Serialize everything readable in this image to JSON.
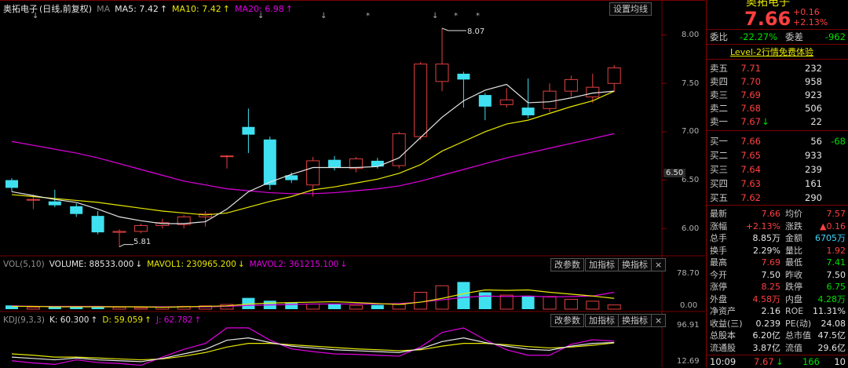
{
  "header": {
    "stock_name": "奥拓电子",
    "period": "(日线,前复权)",
    "ma_label": "MA",
    "ma5": "MA5: 7.42",
    "ma10": "MA10: 7.42",
    "ma20": "MA20: 6.98",
    "arrow_up": "↑",
    "settings_button": "设置均线"
  },
  "colors": {
    "up": "#e24040",
    "down": "#3fe0f0",
    "ma5": "#e6e6e6",
    "ma10": "#e8e800",
    "ma20": "#e000e0",
    "ma_label": "#808080"
  },
  "price_axis": {
    "ticks": [
      "8.00",
      "7.50",
      "7.00",
      "6.50",
      "6.00"
    ],
    "current_box": "6.50"
  },
  "annotations": {
    "high": "8.07",
    "low": "5.81"
  },
  "event_markers": [
    "↓",
    "↓",
    "↓",
    "↓",
    "*",
    "↓",
    "*",
    "*"
  ],
  "volume_panel": {
    "title": "VOL(5,10)",
    "volume": "VOLUME: 88533.000",
    "mavol1": "MAVOL1: 230965.200",
    "mavol2": "MAVOL2: 361215.100",
    "arrow_down": "↓",
    "btn_params": "改参数",
    "btn_add": "加指标",
    "btn_switch": "换指标",
    "btn_close": "×",
    "axis_top": "78.70",
    "axis_bottom": "0.00"
  },
  "kdj_panel": {
    "title": "KDJ(9,3,3)",
    "k": "K: 60.300",
    "d": "D: 59.059",
    "j": "J: 62.782",
    "arrow_up": "↑",
    "btn_params": "改参数",
    "btn_add": "加指标",
    "btn_switch": "换指标",
    "btn_close": "×",
    "axis_top": "96.91",
    "axis_bottom": "12.69"
  },
  "quote": {
    "title": "奥拓电子",
    "price": "7.66",
    "change": "+0.16",
    "change_pct": "+2.13%",
    "weibi_label": "委比",
    "weibi_value": "-22.27%",
    "weicha_label": "委差",
    "weicha_value": "-962",
    "level2": "Level-2行情免费体验",
    "sell": [
      {
        "label": "卖五",
        "price": "7.71",
        "vol": "232",
        "chg": ""
      },
      {
        "label": "卖四",
        "price": "7.70",
        "vol": "958",
        "chg": ""
      },
      {
        "label": "卖三",
        "price": "7.69",
        "vol": "923",
        "chg": ""
      },
      {
        "label": "卖二",
        "price": "7.68",
        "vol": "506",
        "chg": ""
      },
      {
        "label": "卖一",
        "price": "7.67",
        "vol": "22",
        "chg": ""
      }
    ],
    "sell1_arrow": "↓",
    "buy": [
      {
        "label": "买一",
        "price": "7.66",
        "vol": "56",
        "chg": "-68"
      },
      {
        "label": "买二",
        "price": "7.65",
        "vol": "933",
        "chg": ""
      },
      {
        "label": "买三",
        "price": "7.64",
        "vol": "239",
        "chg": ""
      },
      {
        "label": "买四",
        "price": "7.63",
        "vol": "161",
        "chg": ""
      },
      {
        "label": "买五",
        "price": "7.62",
        "vol": "290",
        "chg": ""
      }
    ],
    "stats": [
      {
        "l1": "最新",
        "v1": "7.66",
        "c1": "red",
        "l2": "均价",
        "v2": "7.57",
        "c2": "red"
      },
      {
        "l1": "涨幅",
        "v1": "+2.13%",
        "c1": "red",
        "l2": "涨跌",
        "v2": "▲0.16",
        "c2": "red"
      },
      {
        "l1": "总手",
        "v1": "8.85万",
        "c1": "white",
        "l2": "金额",
        "v2": "6705万",
        "c2": "cyan"
      },
      {
        "l1": "换手",
        "v1": "2.29%",
        "c1": "white",
        "l2": "量比",
        "v2": "1.92",
        "c2": "red"
      },
      {
        "l1": "最高",
        "v1": "7.69",
        "c1": "red",
        "l2": "最低",
        "v2": "7.41",
        "c2": "green"
      },
      {
        "l1": "今开",
        "v1": "7.50",
        "c1": "white",
        "l2": "昨收",
        "v2": "7.50",
        "c2": "white"
      },
      {
        "l1": "涨停",
        "v1": "8.25",
        "c1": "red",
        "l2": "跌停",
        "v2": "6.75",
        "c2": "green"
      },
      {
        "l1": "外盘",
        "v1": "4.58万",
        "c1": "red",
        "l2": "内盘",
        "v2": "4.28万",
        "c2": "green"
      },
      {
        "l1": "净资产",
        "v1": "2.16",
        "c1": "white",
        "l2": "ROE",
        "v2": "11.31%",
        "c2": "white"
      },
      {
        "l1": "收益(三)",
        "v1": "0.239",
        "c1": "white",
        "l2": "PE(动)",
        "v2": "24.08",
        "c2": "white"
      },
      {
        "l1": "总股本",
        "v1": "6.20亿",
        "c1": "white",
        "l2": "总市值",
        "v2": "47.5亿",
        "c2": "white"
      },
      {
        "l1": "流通股",
        "v1": "3.87亿",
        "c1": "white",
        "l2": "流值",
        "v2": "29.6亿",
        "c2": "white"
      }
    ],
    "tick": {
      "time": "10:09",
      "price": "7.67",
      "arrow": "↓",
      "vol": "166",
      "count": "10"
    }
  },
  "chart_data": {
    "type": "candlestick",
    "candles": [
      {
        "o": 6.5,
        "c": 6.42,
        "h": 6.52,
        "l": 6.38
      },
      {
        "o": 6.3,
        "c": 6.3,
        "h": 6.35,
        "l": 6.2
      },
      {
        "o": 6.28,
        "c": 6.24,
        "h": 6.4,
        "l": 6.22
      },
      {
        "o": 6.23,
        "c": 6.15,
        "h": 6.26,
        "l": 6.12
      },
      {
        "o": 6.13,
        "c": 5.96,
        "h": 6.18,
        "l": 5.94
      },
      {
        "o": 5.96,
        "c": 5.97,
        "h": 5.99,
        "l": 5.81
      },
      {
        "o": 5.97,
        "c": 6.03,
        "h": 6.05,
        "l": 5.95
      },
      {
        "o": 6.03,
        "c": 6.06,
        "h": 6.1,
        "l": 6.0
      },
      {
        "o": 6.04,
        "c": 6.12,
        "h": 6.14,
        "l": 6.0
      },
      {
        "o": 6.12,
        "c": 6.15,
        "h": 6.18,
        "l": 6.02
      },
      {
        "o": 6.75,
        "c": 6.75,
        "h": 6.76,
        "l": 6.62
      },
      {
        "o": 7.05,
        "c": 6.97,
        "h": 7.24,
        "l": 6.78
      },
      {
        "o": 6.92,
        "c": 6.45,
        "h": 6.95,
        "l": 6.4
      },
      {
        "o": 6.55,
        "c": 6.5,
        "h": 6.58,
        "l": 6.47
      },
      {
        "o": 6.45,
        "c": 6.7,
        "h": 6.74,
        "l": 6.33
      },
      {
        "o": 6.71,
        "c": 6.63,
        "h": 6.75,
        "l": 6.6
      },
      {
        "o": 6.62,
        "c": 6.72,
        "h": 6.74,
        "l": 6.58
      },
      {
        "o": 6.7,
        "c": 6.64,
        "h": 6.73,
        "l": 6.62
      },
      {
        "o": 6.65,
        "c": 6.98,
        "h": 7.0,
        "l": 6.62
      },
      {
        "o": 6.95,
        "c": 7.7,
        "h": 7.72,
        "l": 6.92
      },
      {
        "o": 7.52,
        "c": 7.7,
        "h": 8.07,
        "l": 7.42
      },
      {
        "o": 7.6,
        "c": 7.54,
        "h": 7.62,
        "l": 7.25
      },
      {
        "o": 7.38,
        "c": 7.26,
        "h": 7.4,
        "l": 7.12
      },
      {
        "o": 7.28,
        "c": 7.33,
        "h": 7.45,
        "l": 7.25
      },
      {
        "o": 7.25,
        "c": 7.17,
        "h": 7.55,
        "l": 7.14
      },
      {
        "o": 7.24,
        "c": 7.42,
        "h": 7.5,
        "l": 7.2
      },
      {
        "o": 7.42,
        "c": 7.54,
        "h": 7.58,
        "l": 7.36
      },
      {
        "o": 7.36,
        "c": 7.46,
        "h": 7.6,
        "l": 7.3
      },
      {
        "o": 7.5,
        "c": 7.66,
        "h": 7.69,
        "l": 7.41
      }
    ],
    "ma5": [
      6.38,
      6.34,
      6.3,
      6.27,
      6.2,
      6.12,
      6.08,
      6.05,
      6.05,
      6.07,
      6.2,
      6.38,
      6.48,
      6.56,
      6.63,
      6.63,
      6.63,
      6.64,
      6.73,
      6.94,
      7.15,
      7.32,
      7.43,
      7.49,
      7.3,
      7.31,
      7.35,
      7.4,
      7.42
    ],
    "ma10": [
      6.35,
      6.33,
      6.31,
      6.29,
      6.27,
      6.24,
      6.21,
      6.18,
      6.16,
      6.14,
      6.16,
      6.22,
      6.28,
      6.33,
      6.4,
      6.43,
      6.47,
      6.51,
      6.57,
      6.66,
      6.8,
      6.9,
      7.0,
      7.08,
      7.12,
      7.19,
      7.26,
      7.32,
      7.42
    ],
    "ma20": [
      6.9,
      6.86,
      6.82,
      6.78,
      6.73,
      6.67,
      6.61,
      6.55,
      6.49,
      6.45,
      6.41,
      6.39,
      6.37,
      6.36,
      6.36,
      6.37,
      6.39,
      6.41,
      6.44,
      6.49,
      6.55,
      6.61,
      6.67,
      6.73,
      6.78,
      6.83,
      6.88,
      6.93,
      6.98
    ],
    "volume": [
      8,
      4,
      5,
      6,
      4,
      4,
      3,
      5,
      6,
      7,
      10,
      24,
      18,
      14,
      11,
      12,
      8,
      9,
      10,
      36,
      50,
      58,
      36,
      30,
      28,
      27,
      21,
      17,
      9
    ],
    "mavol1": [
      6,
      6,
      5,
      5,
      5,
      5,
      5,
      4,
      5,
      6,
      7,
      11,
      13,
      14,
      15,
      16,
      14,
      12,
      10,
      15,
      23,
      33,
      41,
      40,
      41,
      36,
      32,
      28,
      23
    ],
    "mavol2": [
      7,
      6,
      6,
      6,
      6,
      5,
      5,
      5,
      5,
      5,
      6,
      8,
      9,
      10,
      11,
      11,
      11,
      11,
      12,
      15,
      20,
      25,
      28,
      27,
      28,
      26,
      27,
      28,
      36
    ],
    "kdj_k": [
      28,
      25,
      22,
      26,
      22,
      20,
      18,
      25,
      35,
      45,
      65,
      70,
      60,
      52,
      48,
      44,
      42,
      40,
      38,
      46,
      62,
      70,
      60,
      52,
      45,
      43,
      52,
      58,
      60
    ],
    "kdj_d": [
      35,
      32,
      28,
      28,
      26,
      24,
      22,
      24,
      30,
      38,
      50,
      58,
      58,
      55,
      52,
      49,
      46,
      44,
      42,
      44,
      52,
      58,
      58,
      55,
      51,
      48,
      50,
      54,
      59
    ],
    "kdj_j": [
      20,
      15,
      12,
      22,
      16,
      14,
      10,
      28,
      45,
      58,
      92,
      92,
      65,
      46,
      40,
      35,
      34,
      32,
      30,
      50,
      82,
      92,
      66,
      44,
      32,
      32,
      56,
      66,
      63
    ],
    "price_ylim": [
      5.75,
      8.2
    ],
    "kdj_ylim": [
      12.69,
      96.91
    ],
    "vol_ylim": [
      0,
      78.7
    ]
  }
}
